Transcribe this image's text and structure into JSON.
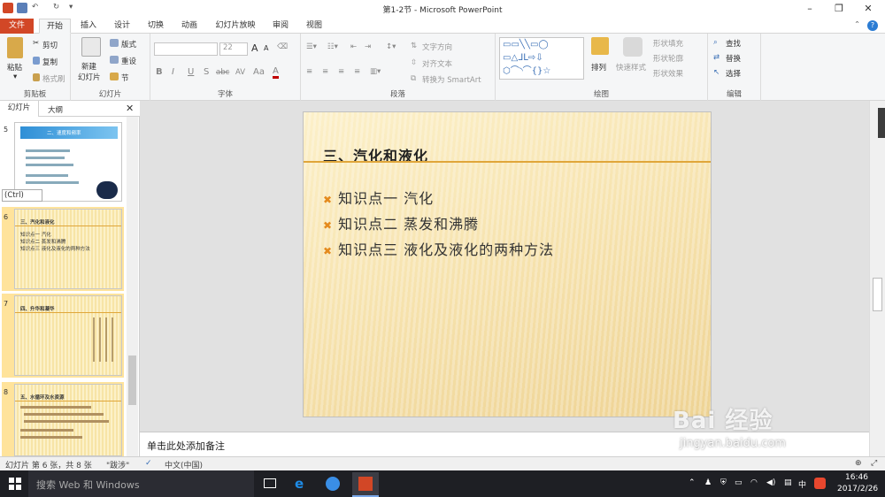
{
  "window": {
    "title": "第1-2节 - Microsoft PowerPoint"
  },
  "tabs": [
    "文件",
    "开始",
    "插入",
    "设计",
    "切换",
    "动画",
    "幻灯片放映",
    "审阅",
    "视图"
  ],
  "ribbon": {
    "clipboard": {
      "paste": "粘贴",
      "cut": "剪切",
      "copy": "复制",
      "format_painter": "格式刷",
      "label": "剪贴板"
    },
    "slides": {
      "new_slide": "新建",
      "new_slide2": "幻灯片",
      "layout": "版式",
      "reset": "重设",
      "section": "节",
      "label": "幻灯片"
    },
    "font": {
      "size": "22",
      "label": "字体",
      "grow": "A",
      "shrink": "A",
      "bold": "B",
      "italic": "I",
      "underline": "U",
      "shadow": "S",
      "strike": "abc",
      "spacing": "AV",
      "case": "Aa",
      "color": "A"
    },
    "paragraph": {
      "text_direction": "文字方向",
      "align_text": "对齐文本",
      "smartart": "转换为 SmartArt",
      "label": "段落"
    },
    "drawing": {
      "arrange": "排列",
      "quick_styles": "快速样式",
      "shape_fill": "形状填充",
      "shape_outline": "形状轮廓",
      "shape_effects": "形状效果",
      "label": "绘图"
    },
    "editing": {
      "find": "查找",
      "replace": "替换",
      "select": "选择",
      "label": "编辑"
    }
  },
  "panel": {
    "tab_slides": "幻灯片",
    "tab_outline": "大纲",
    "paste_options": "(Ctrl)",
    "thumbnails": [
      {
        "num": "5",
        "title": "二、速度和频率"
      },
      {
        "num": "6",
        "title": "三、汽化和液化",
        "lines": [
          "知识点一 汽化",
          "知识点二 蒸发和沸腾",
          "知识点三 液化及液化的两种方法"
        ]
      },
      {
        "num": "7",
        "title": "四、升华和凝华"
      },
      {
        "num": "8",
        "title": "五、水循环及水资源"
      }
    ]
  },
  "slide": {
    "title": "三、汽化和液化",
    "bullets": [
      "知识点一  汽化",
      "知识点二  蒸发和沸腾",
      "知识点三  液化及液化的两种方法"
    ]
  },
  "notes": {
    "placeholder": "单击此处添加备注"
  },
  "status": {
    "slide_info": "幻灯片 第 6 张，共 8 张",
    "theme": "\"跋涉\"",
    "language": "中文(中国)"
  },
  "taskbar": {
    "search": "搜索 Web 和 Windows",
    "time": "16:46",
    "date": "2017/2/26",
    "ime": "中"
  },
  "watermark": {
    "brand": "Bai 经验",
    "url": "jingyan.baidu.com"
  }
}
